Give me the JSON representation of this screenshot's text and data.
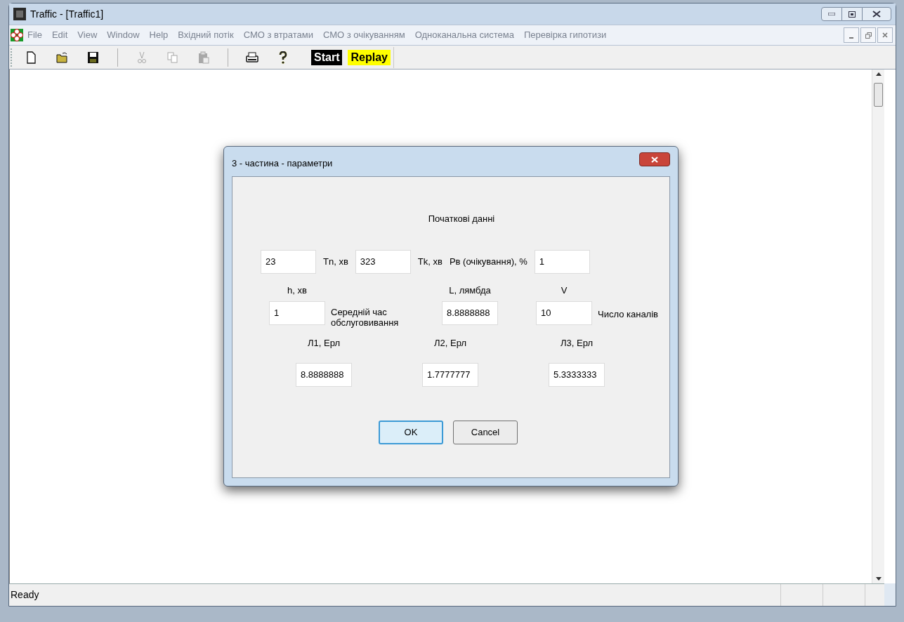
{
  "window": {
    "title": "Traffic - [Traffic1]"
  },
  "menu": {
    "items": [
      "File",
      "Edit",
      "View",
      "Window",
      "Help",
      "Вхідний потік",
      "СМО з втратами",
      "СМО з очікуванням",
      "Одноканальна система",
      "Перевірка гипотизи"
    ]
  },
  "toolbar": {
    "tools": [
      {
        "kind": "new",
        "disabled": false
      },
      {
        "kind": "open",
        "disabled": false
      },
      {
        "kind": "save",
        "disabled": false
      },
      {
        "kind": "separator"
      },
      {
        "kind": "cut",
        "disabled": true
      },
      {
        "kind": "copy",
        "disabled": true
      },
      {
        "kind": "paste",
        "disabled": true
      },
      {
        "kind": "separator"
      },
      {
        "kind": "print",
        "disabled": false
      },
      {
        "kind": "help",
        "disabled": false
      }
    ],
    "text_buttons": [
      {
        "label": "Start",
        "color": "#000000"
      },
      {
        "label": "Replay",
        "color": "#ffff00"
      }
    ]
  },
  "dialog": {
    "title": "3 - частина - параметри",
    "heading": "Початкові данні",
    "row_1": [
      {
        "kind": "field",
        "value": "23"
      },
      {
        "kind": "label",
        "text": "Tn, хв"
      },
      {
        "kind": "field",
        "value": "323"
      },
      {
        "kind": "label",
        "text": "Tk, хв"
      },
      {
        "kind": "label",
        "text": "Pв (очікування), %"
      },
      {
        "kind": "field",
        "value": "1"
      }
    ],
    "row_2": [
      {
        "caption": "h, хв",
        "value": "1",
        "note": "Середній час обслуговивання"
      },
      {
        "caption": "L, лямбда",
        "value": "8.8888888"
      },
      {
        "caption": "V",
        "value": "10",
        "note": "Число каналів"
      }
    ],
    "row_3": [
      {
        "caption": "Л1, Ерл",
        "value": "8.8888888"
      },
      {
        "caption": "Л2, Ерл",
        "value": "1.7777777"
      },
      {
        "caption": "Л3, Ерл",
        "value": "5.3333333"
      }
    ],
    "buttons": [
      {
        "label": "OK",
        "default": true
      },
      {
        "label": "Cancel",
        "default": false
      }
    ]
  },
  "status_bar": {
    "text": "Ready"
  }
}
